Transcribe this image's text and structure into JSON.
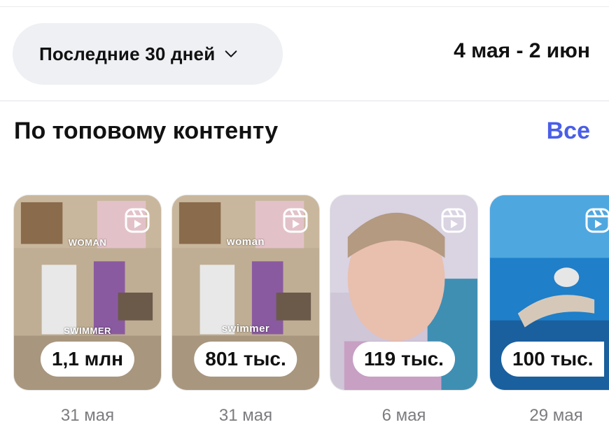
{
  "filter": {
    "period_label": "Последние 30 дней",
    "date_range": "4 мая - 2 июн"
  },
  "section": {
    "title": "По топовому контенту",
    "see_all": "Все"
  },
  "cards": [
    {
      "count": "1,1 млн",
      "date": "31 мая",
      "overlay_top": "WOMAN",
      "overlay_mid": "SWIMMER",
      "icon": "reels-icon"
    },
    {
      "count": "801 тыс.",
      "date": "31 мая",
      "overlay_top": "woman",
      "overlay_mid": "swimmer",
      "icon": "reels-icon"
    },
    {
      "count": "119 тыс.",
      "date": "6 мая",
      "icon": "reels-icon"
    },
    {
      "count": "100 тыс.",
      "date": "29 мая",
      "icon": "reels-icon"
    }
  ],
  "colors": {
    "accent": "#4a5ee8",
    "pill_bg": "#eef0f3",
    "muted": "#7c7c80"
  }
}
